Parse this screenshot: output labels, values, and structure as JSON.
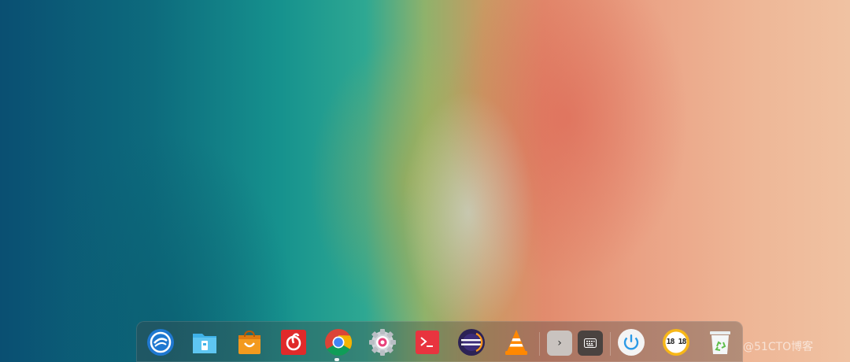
{
  "desktop": {
    "wallpaper": "aerial-beach-wallpaper"
  },
  "dock": {
    "apps": [
      {
        "name": "Launcher",
        "icon": "deepin-launcher-icon"
      },
      {
        "name": "File Manager",
        "icon": "file-manager-icon"
      },
      {
        "name": "App Store",
        "icon": "app-store-icon"
      },
      {
        "name": "NetEase Cloud Music",
        "icon": "netease-music-icon"
      },
      {
        "name": "Google Chrome",
        "icon": "chrome-icon",
        "running": true
      },
      {
        "name": "Control Center",
        "icon": "gear-icon"
      },
      {
        "name": "Terminal",
        "icon": "terminal-icon"
      },
      {
        "name": "Eclipse",
        "icon": "eclipse-icon"
      },
      {
        "name": "VLC Media Player",
        "icon": "vlc-icon"
      }
    ],
    "tray": {
      "expand_label": "›",
      "keyboard_icon": "keyboard-icon"
    },
    "system": [
      {
        "name": "Power",
        "icon": "power-icon"
      },
      {
        "name": "Clock",
        "icon": "clock-icon",
        "time_text": "18 18"
      },
      {
        "name": "Trash",
        "icon": "trash-icon"
      }
    ]
  },
  "watermark": {
    "text": "@51CTO博客"
  },
  "colors": {
    "dock_bg": "#464646",
    "chrome_red": "#db4437",
    "chrome_yellow": "#f4b400",
    "chrome_green": "#0f9d58",
    "chrome_blue": "#4285f4",
    "terminal_red": "#e8343f",
    "power_blue": "#2c9ae6"
  }
}
